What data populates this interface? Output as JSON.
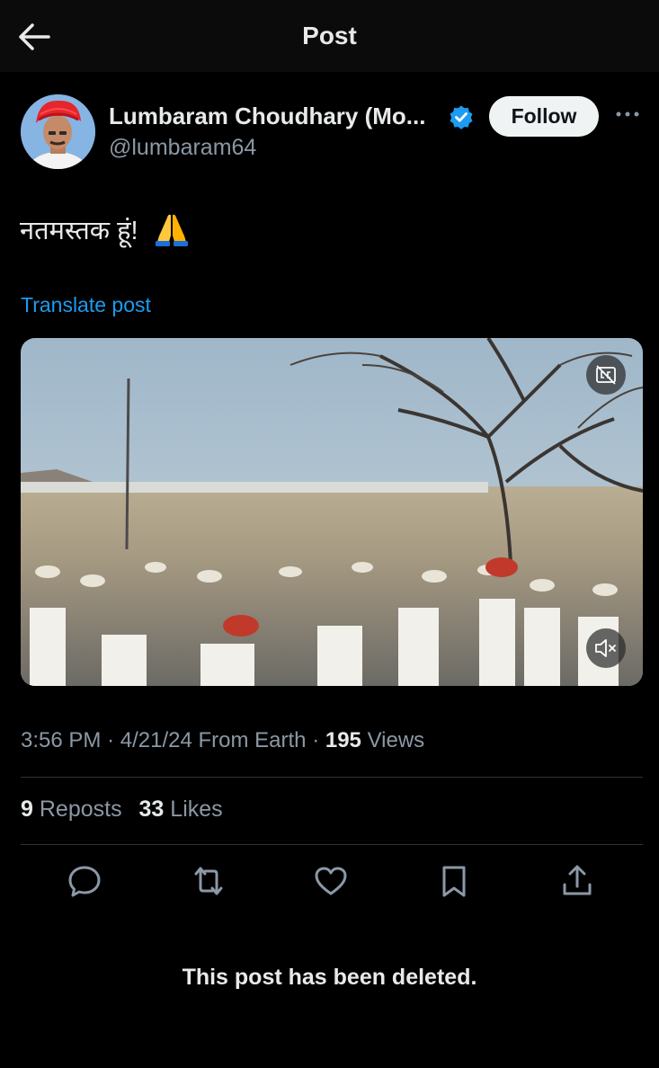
{
  "header": {
    "title": "Post"
  },
  "author": {
    "name": "Lumbaram Choudhary (Mo...",
    "handle": "@lumbaram64",
    "follow_label": "Follow",
    "verified": true
  },
  "post": {
    "text": "नतमस्तक हूं!",
    "emoji": "folded-hands",
    "translate_label": "Translate post"
  },
  "meta": {
    "time": "3:56 PM",
    "date": "4/21/24",
    "location": "From Earth",
    "views_count": "195",
    "views_label": "Views"
  },
  "stats": {
    "reposts_count": "9",
    "reposts_label": "Reposts",
    "likes_count": "33",
    "likes_label": "Likes"
  },
  "actions": [
    "reply-icon",
    "repost-icon",
    "like-icon",
    "bookmark-icon",
    "share-icon"
  ],
  "notice": "This post has been deleted.",
  "colors": {
    "accent": "#1d9bf0",
    "background": "#000000",
    "secondary_text": "#8b98a5"
  }
}
